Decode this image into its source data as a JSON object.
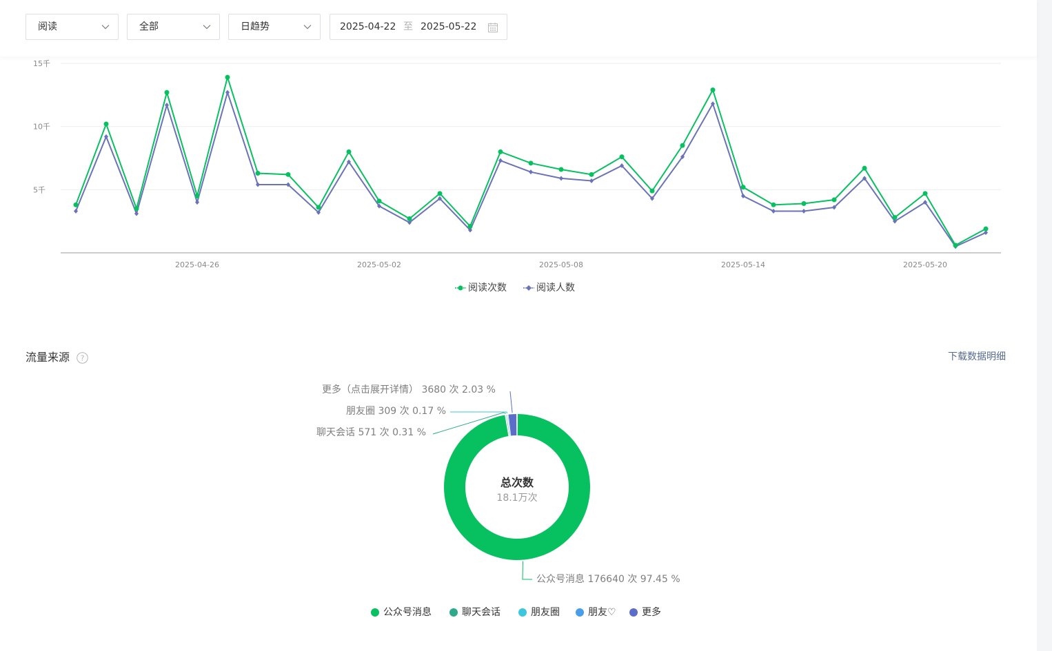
{
  "filters": {
    "metric": "阅读",
    "scope": "全部",
    "granularity": "日趋势",
    "date_start": "2025-04-22",
    "date_separator": "至",
    "date_end": "2025-05-22"
  },
  "colors": {
    "reads_count": "#07c160",
    "readers": "#6a72b8",
    "donut_official": "#07c160",
    "donut_chat": "#2eaa8a",
    "donut_moments": "#3cc6e0",
    "donut_friends": "#4a9de8",
    "donut_more": "#5b6dc9"
  },
  "chart_data": [
    {
      "type": "line",
      "x": [
        "2025-04-22",
        "2025-04-23",
        "2025-04-24",
        "2025-04-25",
        "2025-04-26",
        "2025-04-27",
        "2025-04-28",
        "2025-04-29",
        "2025-04-30",
        "2025-05-01",
        "2025-05-02",
        "2025-05-03",
        "2025-05-04",
        "2025-05-05",
        "2025-05-06",
        "2025-05-07",
        "2025-05-08",
        "2025-05-09",
        "2025-05-10",
        "2025-05-11",
        "2025-05-12",
        "2025-05-13",
        "2025-05-14",
        "2025-05-15",
        "2025-05-16",
        "2025-05-17",
        "2025-05-18",
        "2025-05-19",
        "2025-05-20",
        "2025-05-21",
        "2025-05-22"
      ],
      "x_tick_labels": [
        "2025-04-26",
        "2025-05-02",
        "2025-05-08",
        "2025-05-14",
        "2025-05-20"
      ],
      "y_tick_labels": [
        "5千",
        "10千",
        "15千"
      ],
      "y_ticks": [
        5000,
        10000,
        15000
      ],
      "ylim": [
        0,
        15000
      ],
      "grid": true,
      "legend_position": "bottom-center",
      "series": [
        {
          "name": "阅读次数",
          "marker": "circle",
          "values": [
            3800,
            10200,
            3500,
            12700,
            4500,
            13900,
            6300,
            6200,
            3600,
            8000,
            4100,
            2700,
            4700,
            2100,
            8000,
            7100,
            6600,
            6200,
            7600,
            4900,
            8500,
            12900,
            5200,
            3800,
            3900,
            4200,
            6700,
            2800,
            4700,
            600,
            1900
          ]
        },
        {
          "name": "阅读人数",
          "marker": "diamond",
          "values": [
            3300,
            9200,
            3100,
            11700,
            4000,
            12700,
            5400,
            5400,
            3200,
            7200,
            3700,
            2400,
            4300,
            1800,
            7300,
            6400,
            5900,
            5700,
            6900,
            4300,
            7600,
            11800,
            4500,
            3300,
            3300,
            3600,
            5900,
            2500,
            4000,
            500,
            1600
          ]
        }
      ]
    },
    {
      "type": "pie",
      "title": "总次数",
      "total_label": "18.1万次",
      "slices": [
        {
          "name": "公众号消息",
          "value": 176640,
          "percent": 97.45
        },
        {
          "name": "聊天会话",
          "value": 571,
          "percent": 0.31
        },
        {
          "name": "朋友圈",
          "value": 309,
          "percent": 0.17
        },
        {
          "name": "朋友♡",
          "value": 0,
          "percent": 0
        },
        {
          "name": "更多",
          "value": 3680,
          "percent": 2.03
        }
      ]
    }
  ],
  "source_section": {
    "title": "流量来源",
    "download_label": "下载数据明细",
    "labels": {
      "more": "更多（点击展开详情）  3680 次 2.03 %",
      "moments": "朋友圈 309 次 0.17 %",
      "chat": "聊天会话 571 次 0.31 %",
      "official": "公众号消息 176640 次 97.45 %"
    },
    "legend": [
      "公众号消息",
      "聊天会话",
      "朋友圈",
      "朋友♡",
      "更多"
    ]
  }
}
